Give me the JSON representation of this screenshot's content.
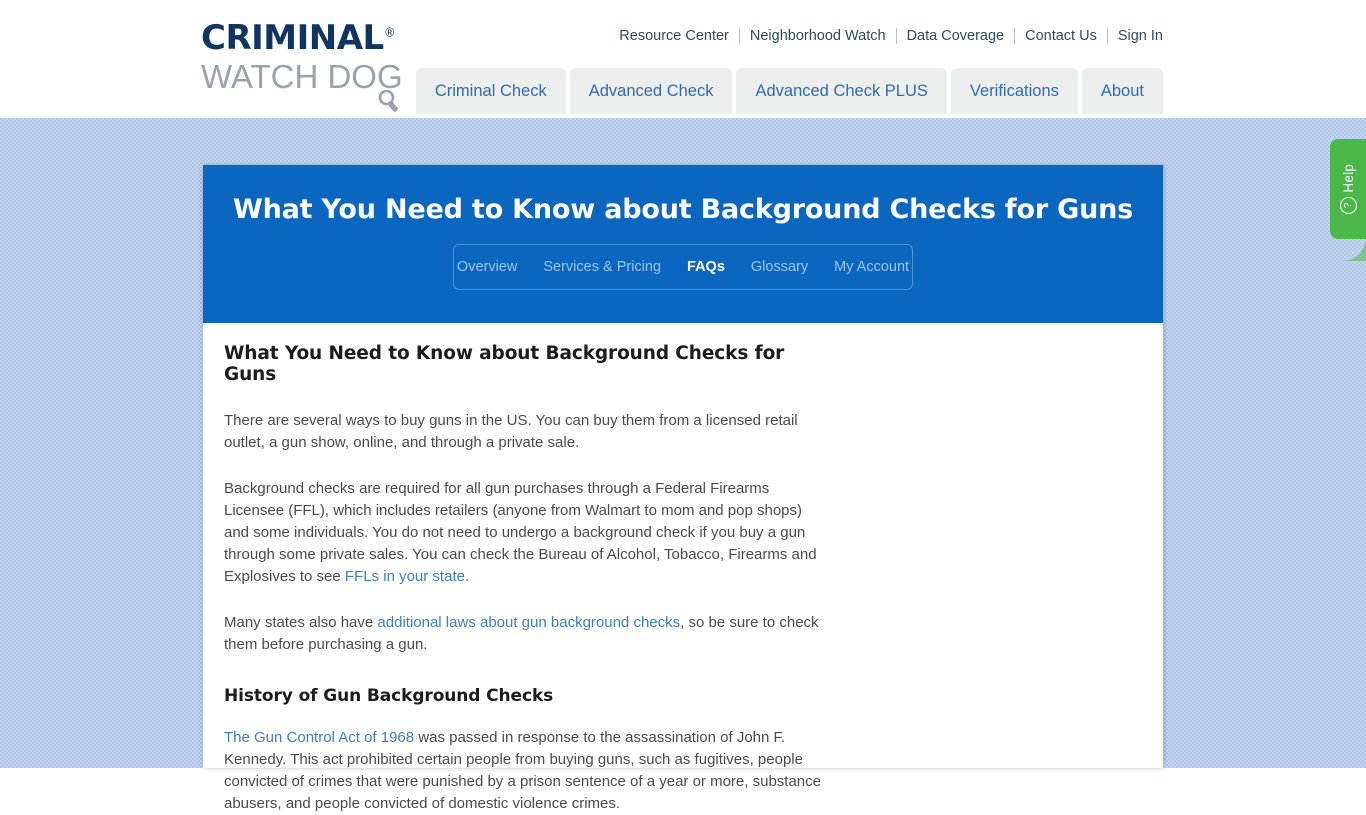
{
  "brand": {
    "name_line1": "CRIMINAL",
    "registered_mark": "®",
    "name_line2": "WATCH DOG",
    "logo_icon": "magnifying-glass-icon",
    "navy": "#10365f",
    "gray": "#98a3ac"
  },
  "utility_nav": {
    "items": [
      {
        "label": "Resource Center"
      },
      {
        "label": "Neighborhood Watch"
      },
      {
        "label": "Data Coverage"
      },
      {
        "label": "Contact Us"
      },
      {
        "label": "Sign In"
      }
    ]
  },
  "main_nav": {
    "tabs": [
      {
        "label": "Criminal Check"
      },
      {
        "label": "Advanced Check"
      },
      {
        "label": "Advanced Check PLUS"
      },
      {
        "label": "Verifications"
      },
      {
        "label": "About"
      }
    ]
  },
  "hero": {
    "title": "What You Need to Know about Background Checks for Guns",
    "background_color": "#0a66bf",
    "sub_tabs": [
      {
        "label": "Overview",
        "active": false
      },
      {
        "label": "Services & Pricing",
        "active": false
      },
      {
        "label": "FAQs",
        "active": true
      },
      {
        "label": "Glossary",
        "active": false
      },
      {
        "label": "My Account",
        "active": false
      }
    ]
  },
  "article": {
    "heading": "What You Need to Know about Background Checks for Guns",
    "p1": "There are several ways to buy guns in the US. You can buy them from a licensed retail outlet, a gun show, online, and through a private sale.",
    "p2_part1": "Background checks are required for all gun purchases through a Federal Firearms Licensee (FFL), which includes retailers (anyone from Walmart to mom and pop shops) and some individuals. You do not need to undergo a background check if you buy a gun through some private sales. You can check the Bureau of Alcohol, Tobacco, Firearms and Explosives to see ",
    "p2_link": "FFLs in your state",
    "p2_part2": ".",
    "p3_part1": "Many states also have ",
    "p3_link": "additional laws about gun background checks",
    "p3_part2": ", so be sure to check them before purchasing a gun.",
    "subheading": "History of Gun Background Checks",
    "p4_link": "The Gun Control Act of 1968",
    "p4_part2": " was passed in response to the assassination of John F. Kennedy. This act prohibited certain people from buying guns, such as fugitives, people convicted of crimes that were punished by a prison sentence of a year or more, substance abusers, and people convicted of domestic violence crimes.",
    "link_color": "#3d7ec0"
  },
  "help_tab": {
    "label": "Help",
    "icon": "question-mark-circle-icon",
    "color": "#4cb749"
  }
}
